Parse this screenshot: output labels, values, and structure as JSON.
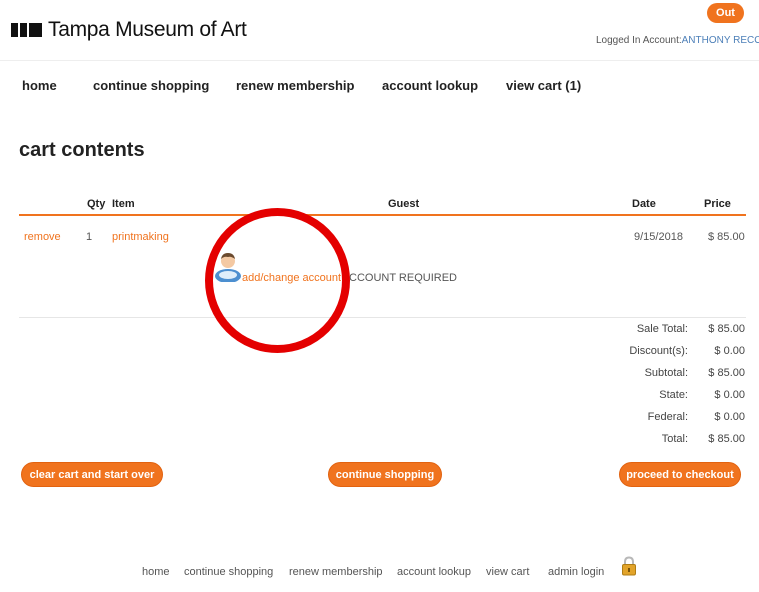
{
  "header": {
    "logo_text": "Tampa Museum of Art",
    "out_label": "Out",
    "logged_prefix": "Logged In Account:",
    "account_name": "ANTHONY RECORD"
  },
  "nav": {
    "items": [
      "home",
      "continue shopping",
      "renew membership",
      "account lookup",
      "view cart (1)"
    ]
  },
  "page_title": "cart contents",
  "table": {
    "headers": {
      "qty": "Qty",
      "item": "Item",
      "guest": "Guest",
      "date": "Date",
      "price": "Price"
    },
    "rows": [
      {
        "remove": "remove",
        "qty": "1",
        "item": "printmaking",
        "date": "9/15/2018",
        "price": "$ 85.00",
        "guest_link": "add/change account",
        "guest_note": "CCOUNT REQUIRED"
      }
    ]
  },
  "totals": [
    {
      "label": "Sale Total:",
      "value": "$ 85.00"
    },
    {
      "label": "Discount(s):",
      "value": "$ 0.00"
    },
    {
      "label": "Subtotal:",
      "value": "$ 85.00"
    },
    {
      "label": "State:",
      "value": "$ 0.00"
    },
    {
      "label": "Federal:",
      "value": "$ 0.00"
    },
    {
      "label": "Total:",
      "value": "$ 85.00"
    }
  ],
  "buttons": {
    "clear": "clear cart and start over",
    "continue": "continue shopping",
    "checkout": "proceed to checkout"
  },
  "footer": {
    "links": [
      "home",
      "continue shopping",
      "renew membership",
      "account lookup",
      "view cart",
      "admin login"
    ]
  },
  "colors": {
    "accent": "#f0731e",
    "highlight": "#e40000",
    "link_blue": "#4c7fb8"
  },
  "icons": [
    "user-icon",
    "lock-icon"
  ]
}
